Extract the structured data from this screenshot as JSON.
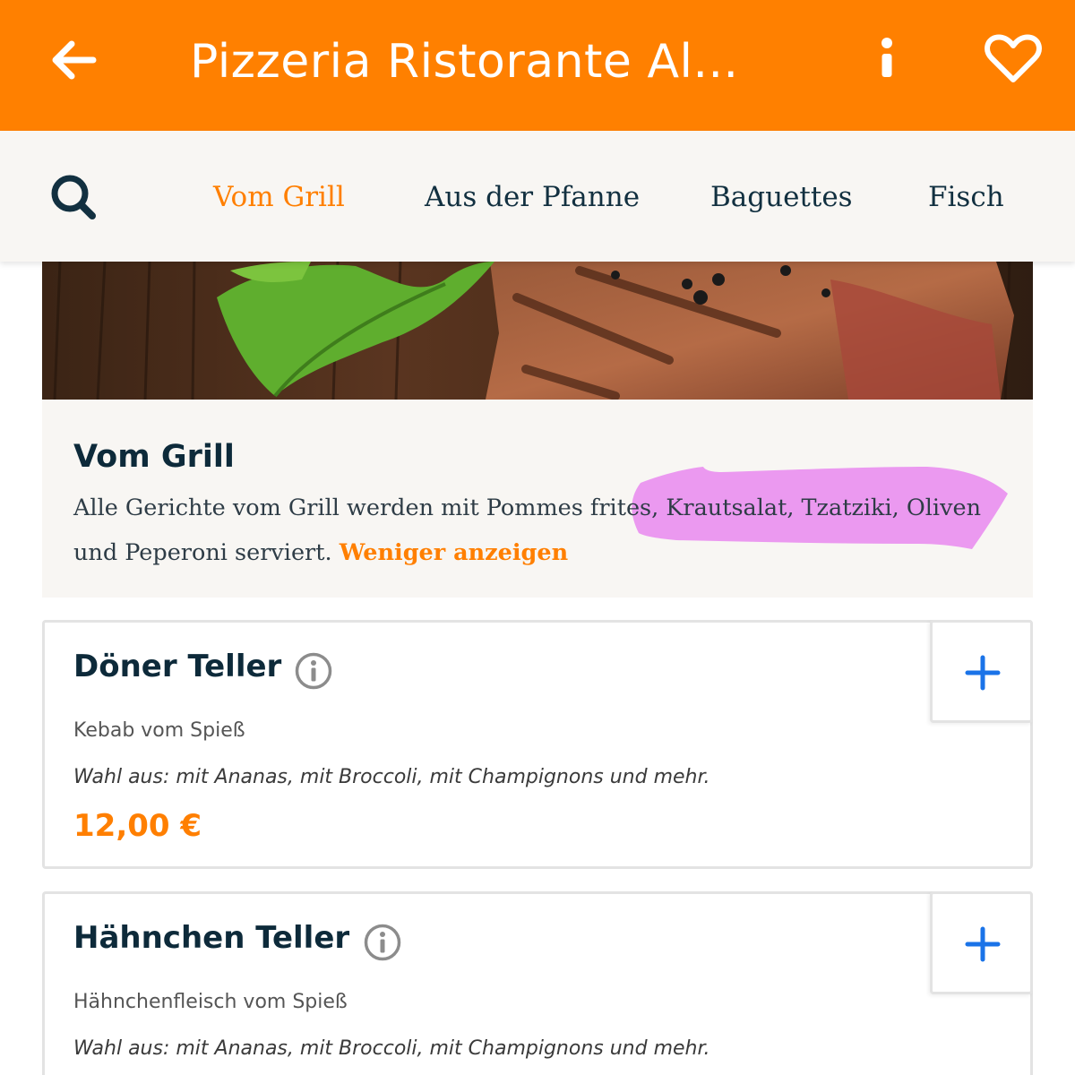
{
  "header": {
    "title": "Pizzeria Ristorante Al...",
    "back_icon": "arrow-left-icon",
    "info_icon": "info-icon",
    "favorite_icon": "heart-icon",
    "background_color": "#ff8000"
  },
  "tabs": {
    "search_icon": "search-icon",
    "items": [
      {
        "label": "Vom Grill",
        "active": true
      },
      {
        "label": "Aus der Pfanne",
        "active": false
      },
      {
        "label": "Baguettes",
        "active": false
      },
      {
        "label": "Fisch",
        "active": false
      }
    ],
    "active_color": "#ff7f00"
  },
  "category": {
    "title": "Vom Grill",
    "description_line1": "Alle Gerichte vom Grill werden mit Pommes frites, Krautsalat, Tzatziki, Oliven",
    "description_line2": "und Peperoni serviert.",
    "toggle_label": "Weniger anzeigen",
    "highlighted_text": "Krautsalat, Tzatziki, Oliven",
    "highlight_color": "#e98ff0"
  },
  "items": [
    {
      "name": "Döner Teller",
      "subtitle": "Kebab vom Spieß",
      "choices": "Wahl aus: mit Ananas, mit Broccoli, mit Champignons und mehr.",
      "price": "12,00 €"
    },
    {
      "name": "Hähnchen Teller",
      "subtitle": "Hähnchenfleisch vom Spieß",
      "choices": "Wahl aus: mit Ananas, mit Broccoli, mit Champignons und mehr."
    }
  ]
}
